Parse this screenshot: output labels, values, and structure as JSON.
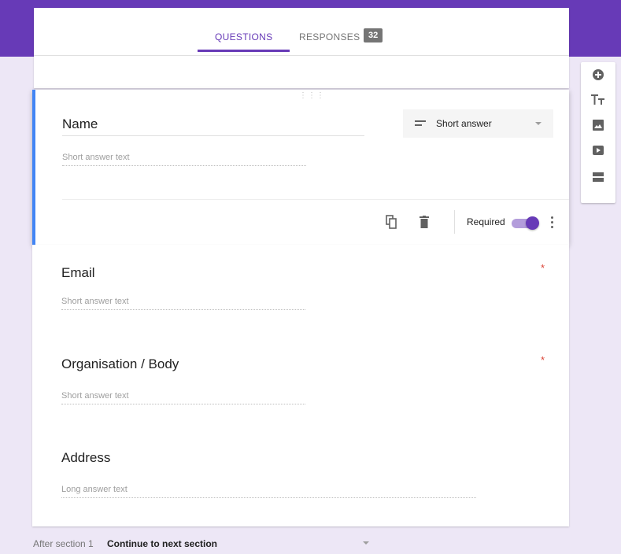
{
  "tabs": {
    "questions_label": "QUESTIONS",
    "responses_label": "RESPONSES",
    "responses_count": "32"
  },
  "toolbar": {
    "icons": [
      "add-question-icon",
      "title-text-icon",
      "image-icon",
      "video-icon",
      "section-icon"
    ]
  },
  "active_question": {
    "title": "Name",
    "type_label": "Short answer",
    "answer_hint": "Short answer text",
    "required_label": "Required",
    "required": true
  },
  "questions": [
    {
      "title": "Email",
      "answer_hint": "Short answer text",
      "required_mark": "*"
    },
    {
      "title": "Organisation / Body",
      "answer_hint": "Short answer text",
      "required_mark": "*"
    },
    {
      "title": "Address",
      "answer_hint": "Long answer text"
    }
  ],
  "after_section": {
    "label": "After section 1",
    "value": "Continue to next section"
  },
  "colors": {
    "accent": "#673ab7",
    "accent_light": "#b39ddb",
    "active_border": "#4285f4",
    "background": "#ede7f6",
    "required_star": "#db4437"
  }
}
